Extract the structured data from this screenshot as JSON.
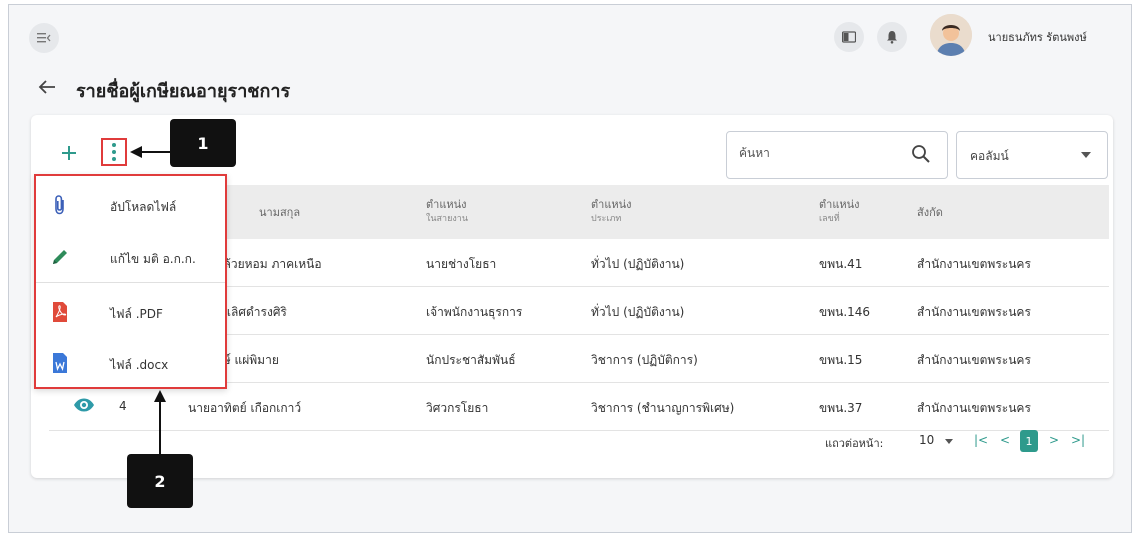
{
  "topbar": {
    "user_name": "นายธนภัทร รัตนพงษ์"
  },
  "page": {
    "title": "รายชื่อผู้เกษียณอายุราชการ"
  },
  "toolbar": {
    "search_placeholder": "ค้นหา",
    "column_select_label": "คอลัมน์"
  },
  "callouts": [
    "1",
    "2"
  ],
  "menu": {
    "items": [
      {
        "label": "อัปโหลดไฟล์",
        "icon": "paperclip-icon"
      },
      {
        "label": "แก้ไข มติ อ.ก.ก.",
        "icon": "pencil-icon"
      },
      {
        "label": "ไฟล์ .PDF",
        "icon": "pdf-file-icon"
      },
      {
        "label": "ไฟล์ .docx",
        "icon": "word-file-icon"
      }
    ]
  },
  "table": {
    "headers": {
      "name": "นามสกุล",
      "pos_line": "ตำแหน่ง",
      "pos_line_sub": "ในสายงาน",
      "pos_type": "ตำแหน่ง",
      "pos_type_sub": "ประเภท",
      "pos_no": "ตำแหน่ง",
      "pos_no_sub": "เลขที่",
      "org": "สังกัด"
    },
    "rows": [
      {
        "num": "",
        "name": "อกล้วยหอม ภาคเหนือ",
        "pos_line": "นายช่างโยธา",
        "pos_type": "ทั่วไป (ปฏิบัติงาน)",
        "pos_no": "ขพน.41",
        "org": "สำนักงานเขตพระนคร"
      },
      {
        "num": "",
        "name": "ลา เลิศดำรงศิริ",
        "pos_line": "เจ้าพนักงานธุรการ",
        "pos_type": "ทั่วไป (ปฏิบัติงาน)",
        "pos_no": "ขพน.146",
        "org": "สำนักงานเขตพระนคร"
      },
      {
        "num": "",
        "name": "พงษ์ แผ่พิมาย",
        "pos_line": "นักประชาสัมพันธ์",
        "pos_type": "วิชาการ (ปฏิบัติการ)",
        "pos_no": "ขพน.15",
        "org": "สำนักงานเขตพระนคร"
      },
      {
        "num": "4",
        "name": "นายอาทิตย์ เกือกเกาว์",
        "pos_line": "วิศวกรโยธา",
        "pos_type": "วิชาการ (ชำนาญการพิเศษ)",
        "pos_no": "ขพน.37",
        "org": "สำนักงานเขตพระนคร"
      }
    ]
  },
  "pagination": {
    "rows_label": "แถวต่อหน้า:",
    "rows_value": "10",
    "first": "|<",
    "prev": "<",
    "current": "1",
    "next": ">",
    "last": ">|"
  },
  "colors": {
    "accent": "#2e9a8c",
    "highlight": "#e03b3b"
  }
}
